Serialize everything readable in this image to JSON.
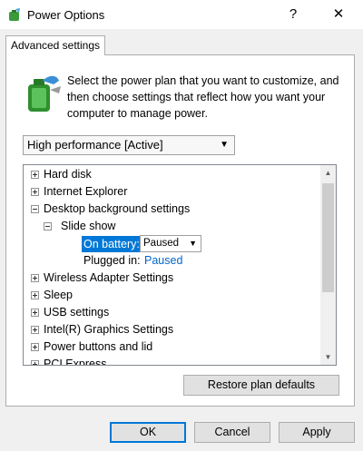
{
  "window": {
    "title": "Power Options",
    "help_label": "?",
    "close_label": "✕"
  },
  "tab": {
    "label": "Advanced settings"
  },
  "description": "Select the power plan that you want to customize, and then choose settings that reflect how you want your computer to manage power.",
  "plan_select": {
    "value": "High performance [Active]"
  },
  "tree": {
    "items": [
      {
        "label": "Hard disk",
        "expander": "+"
      },
      {
        "label": "Internet Explorer",
        "expander": "+"
      },
      {
        "label": "Desktop background settings",
        "expander": "-"
      },
      {
        "label": "Slide show",
        "expander": "-"
      },
      {
        "label": "Wireless Adapter Settings",
        "expander": "+"
      },
      {
        "label": "Sleep",
        "expander": "+"
      },
      {
        "label": "USB settings",
        "expander": "+"
      },
      {
        "label": "Intel(R) Graphics Settings",
        "expander": "+"
      },
      {
        "label": "Power buttons and lid",
        "expander": "+"
      },
      {
        "label": "PCI Express",
        "expander": "+"
      }
    ],
    "on_battery": {
      "label": "On battery:",
      "value": "Paused"
    },
    "plugged_in": {
      "label": "Plugged in:",
      "value": "Paused"
    }
  },
  "buttons": {
    "restore": "Restore plan defaults",
    "ok": "OK",
    "cancel": "Cancel",
    "apply": "Apply"
  },
  "colors": {
    "selection": "#0078d7",
    "link_value": "#0066cc"
  }
}
